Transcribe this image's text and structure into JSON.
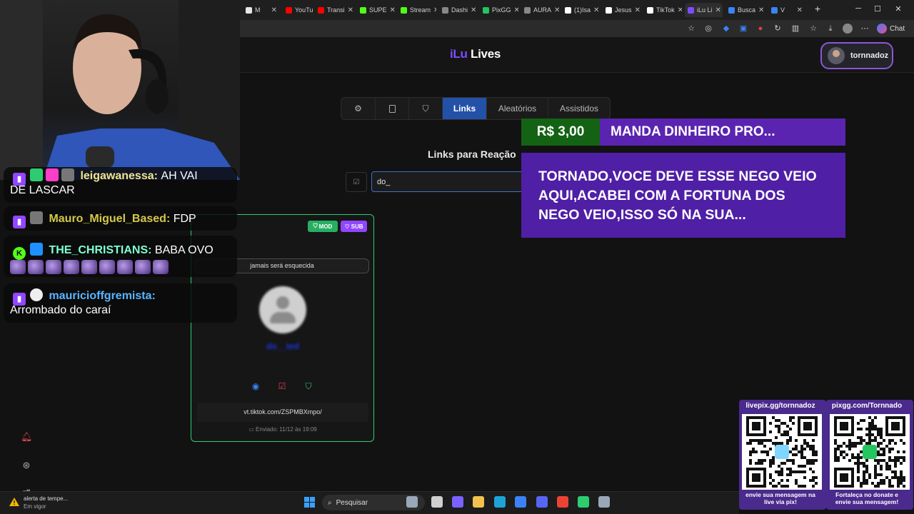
{
  "browser": {
    "tabs": [
      {
        "label": "M",
        "color": "#e6e6e6"
      },
      {
        "label": "YouTub",
        "color": "#ff0000"
      },
      {
        "label": "Transi",
        "color": "#ff0000"
      },
      {
        "label": "SUPE",
        "color": "#53fc18"
      },
      {
        "label": "Stream",
        "color": "#53fc18"
      },
      {
        "label": "Dashi",
        "color": "#888888"
      },
      {
        "label": "PixGG",
        "color": "#22c55e"
      },
      {
        "label": "AURA",
        "color": "#888888"
      },
      {
        "label": "(1)Isa",
        "color": "#ffffff"
      },
      {
        "label": "Jesus",
        "color": "#ffffff"
      },
      {
        "label": "TikTok",
        "color": "#ffffff"
      },
      {
        "label": "iLu Li",
        "color": "#7c4dff"
      },
      {
        "label": "Busca",
        "color": "#3b82f6"
      },
      {
        "label": "V",
        "color": "#3b82f6"
      }
    ],
    "chat_button": "Chat"
  },
  "app": {
    "logo_a": "iLu",
    "logo_b": "Lives",
    "username": "tornnadoz",
    "tabs": [
      "Links",
      "Aleatórios",
      "Assistidos"
    ],
    "section_title": "Links para Reação",
    "search_value": "do_"
  },
  "card": {
    "badge_mod": "MOD",
    "badge_sub": "SUB",
    "message": "jamais será esquecida",
    "name": "do__ted",
    "link": "vt.tiktok.com/ZSPMBXmpo/",
    "date": "Enviado: 11/12 às 19:09"
  },
  "chat": [
    {
      "user": "leigawanessa:",
      "message": "AH VAI",
      "message2": "DE LASCAR",
      "color": "#f0e68c"
    },
    {
      "user": "Mauro_Miguel_Based:",
      "message": "FDP",
      "color": "#d4c84a"
    },
    {
      "user": "THE_CHRISTIANS:",
      "message": "BABA OVO",
      "color": "#7fffd4"
    },
    {
      "user": "mauricioffgremista:",
      "message": "Arrombado do caraí",
      "color": "#5ab4ff"
    }
  ],
  "donation": {
    "amount": "R$ 3,00",
    "name": "MANDA DINHEIRO PRO...",
    "message": "TORNADO,VOCE DEVE ESSE NEGO VEIO AQUI,ACABEI COM A FORTUNA DOS NEGO VEIO,ISSO SÓ NA SUA..."
  },
  "qr": [
    {
      "title": "livepix.gg/tornnadoz",
      "caption1": "envie sua mensagem na",
      "caption2": "live via pix!",
      "accent": "#7fd6ff"
    },
    {
      "title": "pixgg.com/Tornnado",
      "caption1": "Fortaleça no donate e",
      "caption2": "envie sua mensagem!",
      "accent": "#22c55e"
    }
  ],
  "taskbar": {
    "weather_title": "alerta de tempe...",
    "weather_sub": "Em vigor",
    "search": "Pesquisar"
  }
}
